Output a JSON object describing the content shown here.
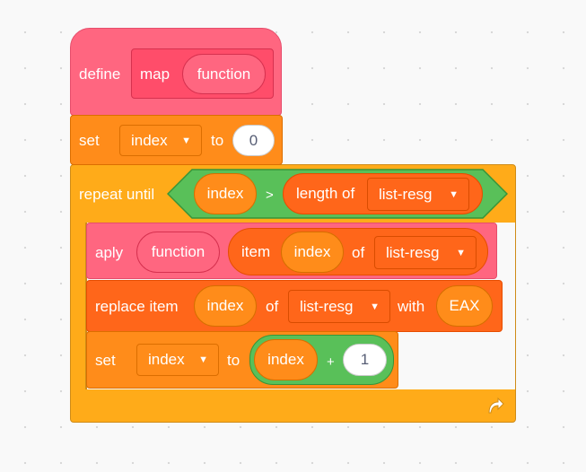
{
  "define": {
    "keyword": "define",
    "name": "map",
    "param": "function"
  },
  "set1": {
    "label": "set",
    "variable": "index",
    "to": "to",
    "value": "0"
  },
  "repeat": {
    "label": "repeat until",
    "var": "index",
    "op": ">",
    "length_label": "length of",
    "list": "list-resg",
    "loop_icon": "loop-arrow-icon"
  },
  "apply": {
    "label": "aply",
    "param": "function",
    "item_label": "item",
    "index": "index",
    "of": "of",
    "list": "list-resg"
  },
  "replace": {
    "label": "replace item",
    "index": "index",
    "of": "of",
    "list": "list-resg",
    "with": "with",
    "value": "EAX"
  },
  "set2": {
    "label": "set",
    "variable": "index",
    "to": "to",
    "left": "index",
    "op": "+",
    "right": "1"
  },
  "colors": {
    "custom": "#ff6680",
    "custom_dark": "#ff4d6a",
    "control": "#ffab19",
    "variables": "#ff8c1a",
    "operators": "#59c059",
    "list": "#ff661a"
  }
}
